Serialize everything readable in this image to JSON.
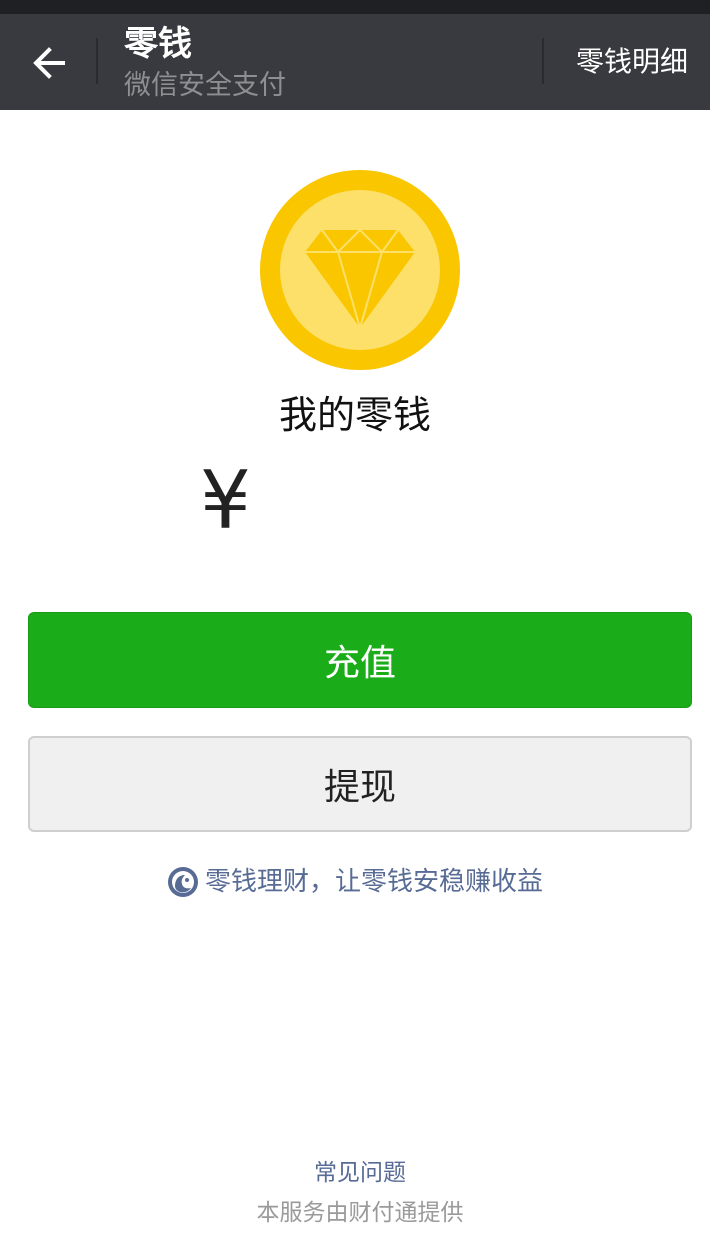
{
  "nav": {
    "title": "零钱",
    "subtitle": "微信安全支付",
    "right_link": "零钱明细"
  },
  "wallet": {
    "title": "我的零钱",
    "currency_symbol": "¥",
    "icon": "diamond-coin-icon"
  },
  "actions": {
    "recharge_label": "充值",
    "withdraw_label": "提现"
  },
  "promo": {
    "label": "零钱理财，让零钱安稳赚收益",
    "icon": "licaitong-icon"
  },
  "footer": {
    "faq_label": "常见问题",
    "provider_text": "本服务由财付通提供"
  },
  "colors": {
    "nav_bg": "#393a3f",
    "primary_green": "#1aad19",
    "link_blue": "#576b95",
    "coin_outer": "#f9c600",
    "coin_inner": "#fde06a"
  }
}
